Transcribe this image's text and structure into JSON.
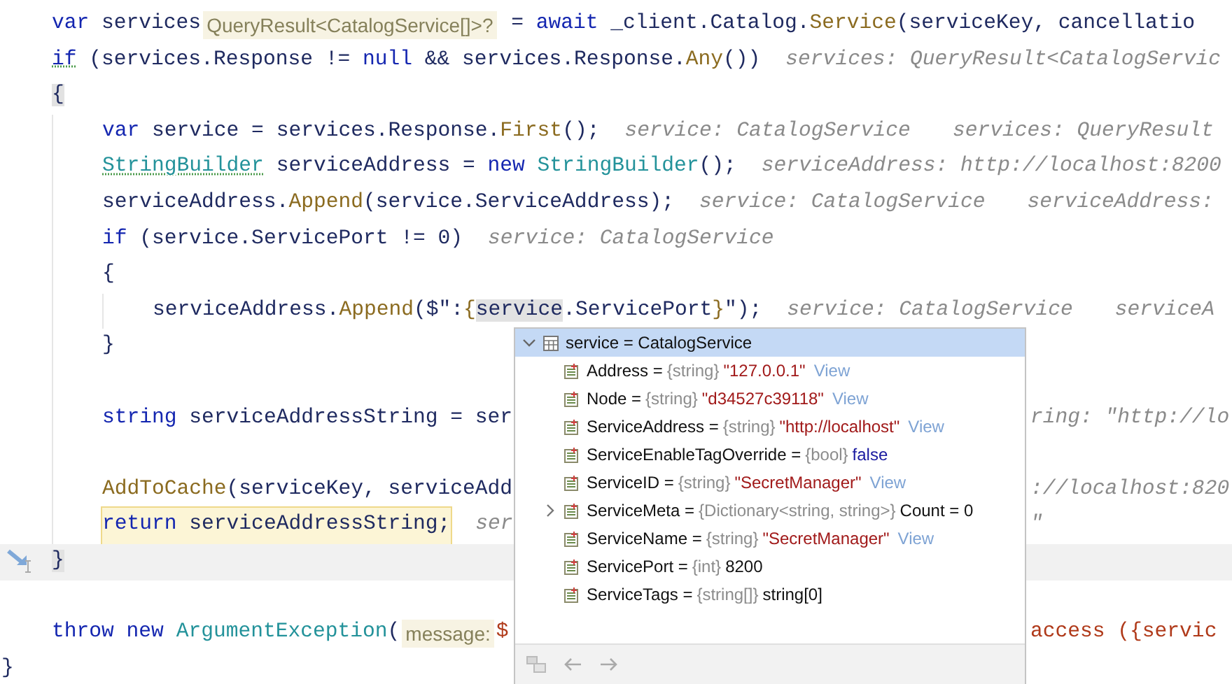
{
  "code": [
    {
      "children": [
        {
          "segments": [
            {
              "kind": "code",
              "tokens": [
                {
                  "kind": "keyword",
                  "text": "var"
                },
                {
                  "kind": "plain",
                  "text": " services"
                }
              ]
            },
            {
              "kind": "type_hint",
              "text": "QueryResult<CatalogService[]>?"
            },
            {
              "kind": "code",
              "tokens": [
                {
                  "kind": "plain",
                  "text": " = "
                },
                {
                  "kind": "keyword",
                  "text": "await"
                },
                {
                  "kind": "plain",
                  "text": " _client.Catalog."
                },
                {
                  "kind": "method",
                  "text": "Service"
                },
                {
                  "kind": "plain",
                  "text": "(serviceKey, cancellatio"
                }
              ]
            }
          ]
        },
        {
          "segments": [
            {
              "kind": "code",
              "tokens": [
                {
                  "kind": "keyword",
                  "text": "if",
                  "dotted": true
                },
                {
                  "kind": "plain",
                  "text": " (services.Response != "
                },
                {
                  "kind": "keyword",
                  "text": "null"
                },
                {
                  "kind": "plain",
                  "text": " && services.Response."
                },
                {
                  "kind": "method",
                  "text": "Any"
                },
                {
                  "kind": "plain",
                  "text": "())"
                }
              ]
            },
            {
              "kind": "value_hint",
              "text": "services: QueryResult<CatalogServic"
            }
          ]
        },
        {
          "segments": [
            {
              "kind": "code",
              "tokens": [
                {
                  "kind": "plain",
                  "text": "{",
                  "marked": true
                }
              ]
            }
          ]
        },
        {
          "children": [
            {
              "segments": [
                {
                  "kind": "code",
                  "tokens": [
                    {
                      "kind": "keyword",
                      "text": "var"
                    },
                    {
                      "kind": "plain",
                      "text": " service = services.Response."
                    },
                    {
                      "kind": "method",
                      "text": "First"
                    },
                    {
                      "kind": "plain",
                      "text": "();"
                    }
                  ]
                },
                {
                  "kind": "value_hint",
                  "text": "service: CatalogService"
                },
                {
                  "kind": "value_hint",
                  "text": "services: QueryResult"
                }
              ]
            },
            {
              "segments": [
                {
                  "kind": "code",
                  "tokens": [
                    {
                      "kind": "type",
                      "text": "StringBuilder",
                      "dotted": true
                    },
                    {
                      "kind": "plain",
                      "text": " serviceAddress = "
                    },
                    {
                      "kind": "keyword",
                      "text": "new"
                    },
                    {
                      "kind": "type",
                      "text": " StringBuilder"
                    },
                    {
                      "kind": "plain",
                      "text": "();"
                    }
                  ]
                },
                {
                  "kind": "value_hint",
                  "text": "serviceAddress: http://localhost:8200"
                }
              ]
            },
            {
              "segments": [
                {
                  "kind": "code",
                  "tokens": [
                    {
                      "kind": "plain",
                      "text": "serviceAddress."
                    },
                    {
                      "kind": "method",
                      "text": "Append"
                    },
                    {
                      "kind": "plain",
                      "text": "(service.ServiceAddress);"
                    }
                  ]
                },
                {
                  "kind": "value_hint",
                  "text": "service: CatalogService"
                },
                {
                  "kind": "value_hint",
                  "text": "serviceAddress:"
                }
              ]
            },
            {
              "segments": [
                {
                  "kind": "code",
                  "tokens": [
                    {
                      "kind": "keyword",
                      "text": "if"
                    },
                    {
                      "kind": "plain",
                      "text": " (service.ServicePort != 0)"
                    }
                  ]
                },
                {
                  "kind": "value_hint",
                  "text": "service: CatalogService"
                }
              ]
            },
            {
              "segments": [
                {
                  "kind": "code",
                  "tokens": [
                    {
                      "kind": "plain",
                      "text": "{"
                    }
                  ]
                }
              ]
            },
            {
              "children": [
                {
                  "segments": [
                    {
                      "kind": "code",
                      "tokens": [
                        {
                          "kind": "plain",
                          "text": "serviceAddress."
                        },
                        {
                          "kind": "method",
                          "text": "Append"
                        },
                        {
                          "kind": "plain",
                          "text": "($\":"
                        },
                        {
                          "kind": "method",
                          "text": "{"
                        },
                        {
                          "kind": "plain",
                          "text": "service",
                          "marked": true
                        },
                        {
                          "kind": "plain",
                          "text": ".ServicePort"
                        },
                        {
                          "kind": "method",
                          "text": "}"
                        },
                        {
                          "kind": "plain",
                          "text": "\");"
                        }
                      ]
                    },
                    {
                      "kind": "value_hint",
                      "text": "service: CatalogService"
                    },
                    {
                      "kind": "value_hint",
                      "text": "serviceA"
                    }
                  ]
                }
              ]
            },
            {
              "segments": [
                {
                  "kind": "code",
                  "tokens": [
                    {
                      "kind": "plain",
                      "text": "}"
                    }
                  ]
                }
              ]
            },
            {
              "gap_before": true,
              "segments": [
                {
                  "kind": "code",
                  "tokens": [
                    {
                      "kind": "keyword",
                      "text": "string"
                    },
                    {
                      "kind": "plain",
                      "text": " serviceAddressString = ser"
                    }
                  ]
                }
              ],
              "segments_right": [
                {
                  "kind": "value_hint",
                  "text": "ring: \"http://lo"
                }
              ]
            },
            {
              "gap_before": true,
              "segments": [
                {
                  "kind": "code",
                  "tokens": [
                    {
                      "kind": "method",
                      "text": "AddToCache"
                    },
                    {
                      "kind": "plain",
                      "text": "(serviceKey, serviceAdd"
                    }
                  ]
                }
              ],
              "segments_right": [
                {
                  "kind": "value_hint",
                  "text": "://localhost:820"
                }
              ]
            },
            {
              "segments": [
                {
                  "kind": "code",
                  "highlighted": true,
                  "tokens": [
                    {
                      "kind": "keyword",
                      "text": "return"
                    },
                    {
                      "kind": "plain",
                      "text": " serviceAddressString;"
                    }
                  ]
                },
                {
                  "kind": "value_hint",
                  "text": "ser"
                }
              ],
              "segments_right": [
                {
                  "kind": "value_hint",
                  "text": "\""
                }
              ]
            }
          ]
        },
        {
          "current": true,
          "segments": [
            {
              "kind": "code",
              "tokens": [
                {
                  "kind": "plain",
                  "text": "}",
                  "marked": true
                }
              ]
            }
          ]
        },
        {
          "gap_before": true,
          "segments": [
            {
              "kind": "code",
              "tokens": [
                {
                  "kind": "keyword",
                  "text": "throw"
                },
                {
                  "kind": "keyword",
                  "text": " new"
                },
                {
                  "kind": "type",
                  "text": " ArgumentException"
                },
                {
                  "kind": "plain",
                  "text": "("
                }
              ]
            },
            {
              "kind": "type_hint",
              "text": "message:"
            },
            {
              "kind": "code",
              "tokens": [
                {
                  "kind": "string",
                  "text": "$"
                }
              ]
            }
          ],
          "segments_right": [
            {
              "kind": "code",
              "tokens": [
                {
                  "kind": "string",
                  "text": "access ({servic"
                }
              ]
            }
          ]
        }
      ]
    },
    {
      "segments": [
        {
          "kind": "code",
          "tokens": [
            {
              "kind": "plain",
              "text": "}"
            }
          ]
        }
      ]
    }
  ],
  "popup": {
    "header": {
      "text": "service = CatalogService",
      "expanded": true,
      "selected": true
    },
    "rows": [
      {
        "name": "Address =",
        "type": "{string}",
        "value": "\"127.0.0.1\"",
        "kind": "string",
        "link": "View",
        "expandable": false,
        "selected": false
      },
      {
        "name": "Node =",
        "type": "{string}",
        "value": "\"d34527c39118\"",
        "kind": "string",
        "link": "View",
        "expandable": false,
        "selected": false
      },
      {
        "name": "ServiceAddress =",
        "type": "{string}",
        "value": "\"http://localhost\"",
        "kind": "string",
        "link": "View",
        "expandable": false,
        "selected": false
      },
      {
        "name": "ServiceEnableTagOverride =",
        "type": "{bool}",
        "value": "false",
        "kind": "keyword",
        "expandable": false,
        "selected": false
      },
      {
        "name": "ServiceID =",
        "type": "{string}",
        "value": "\"SecretManager\"",
        "kind": "string",
        "link": "View",
        "expandable": false,
        "selected": false
      },
      {
        "name": "ServiceMeta =",
        "type": "{Dictionary<string, string>}",
        "value": "Count = 0",
        "kind": "plain",
        "expandable": true,
        "selected": false
      },
      {
        "name": "ServiceName =",
        "type": "{string}",
        "value": "\"SecretManager\"",
        "kind": "string",
        "link": "View",
        "expandable": false,
        "selected": false
      },
      {
        "name": "ServicePort =",
        "type": "{int}",
        "value": "8200",
        "kind": "plain",
        "expandable": false,
        "selected": false
      },
      {
        "name": "ServiceTags =",
        "type": "{string[]}",
        "value": "string[0]",
        "kind": "plain",
        "expandable": false,
        "selected": false
      }
    ]
  }
}
